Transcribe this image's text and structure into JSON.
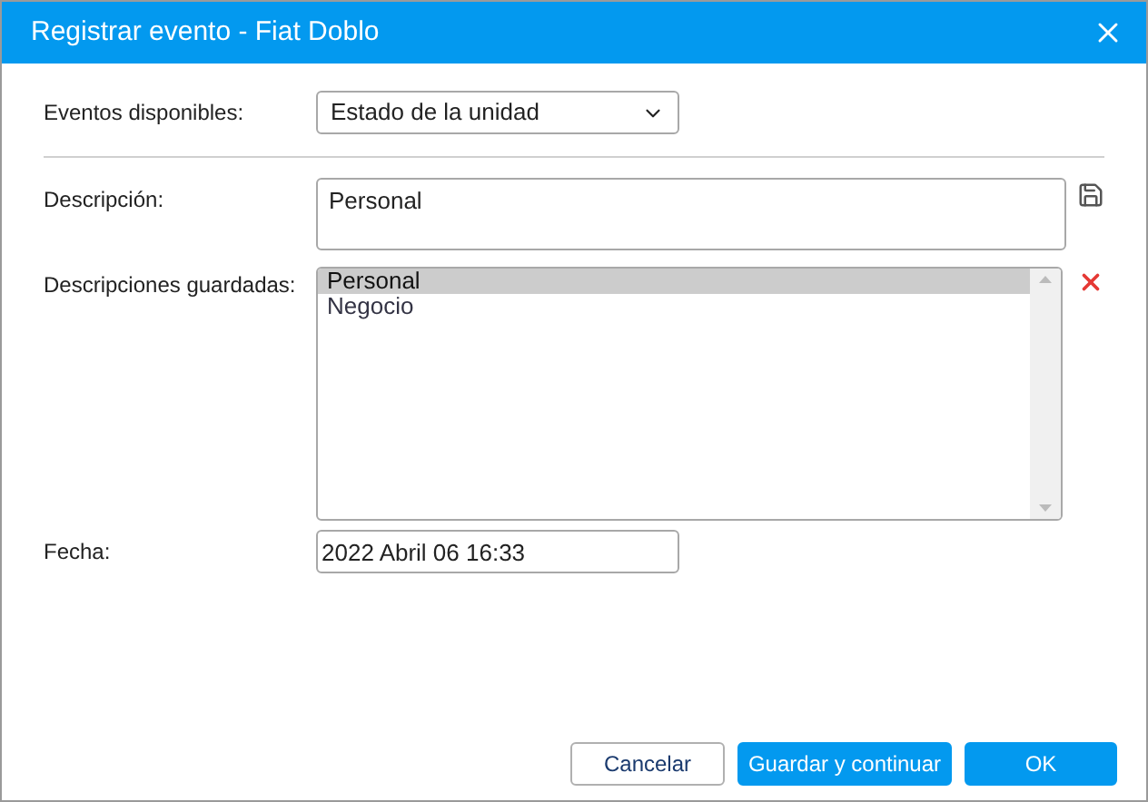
{
  "window": {
    "title": "Registrar evento - Fiat Doblo"
  },
  "events": {
    "label": "Eventos disponibles:",
    "value": "Estado de la unidad"
  },
  "description": {
    "label": "Descripción:",
    "value": "Personal"
  },
  "saved": {
    "label": "Descripciones guardadas:",
    "items": [
      {
        "text": "Personal",
        "selected": true
      },
      {
        "text": "Negocio",
        "selected": false
      }
    ]
  },
  "date": {
    "label": "Fecha:",
    "value": "2022 Abril 06 16:33"
  },
  "buttons": [
    {
      "label": "Cancelar",
      "kind": "secondary"
    },
    {
      "label": "Guardar y continuar",
      "kind": "primary"
    },
    {
      "label": "OK",
      "kind": "primary"
    }
  ]
}
